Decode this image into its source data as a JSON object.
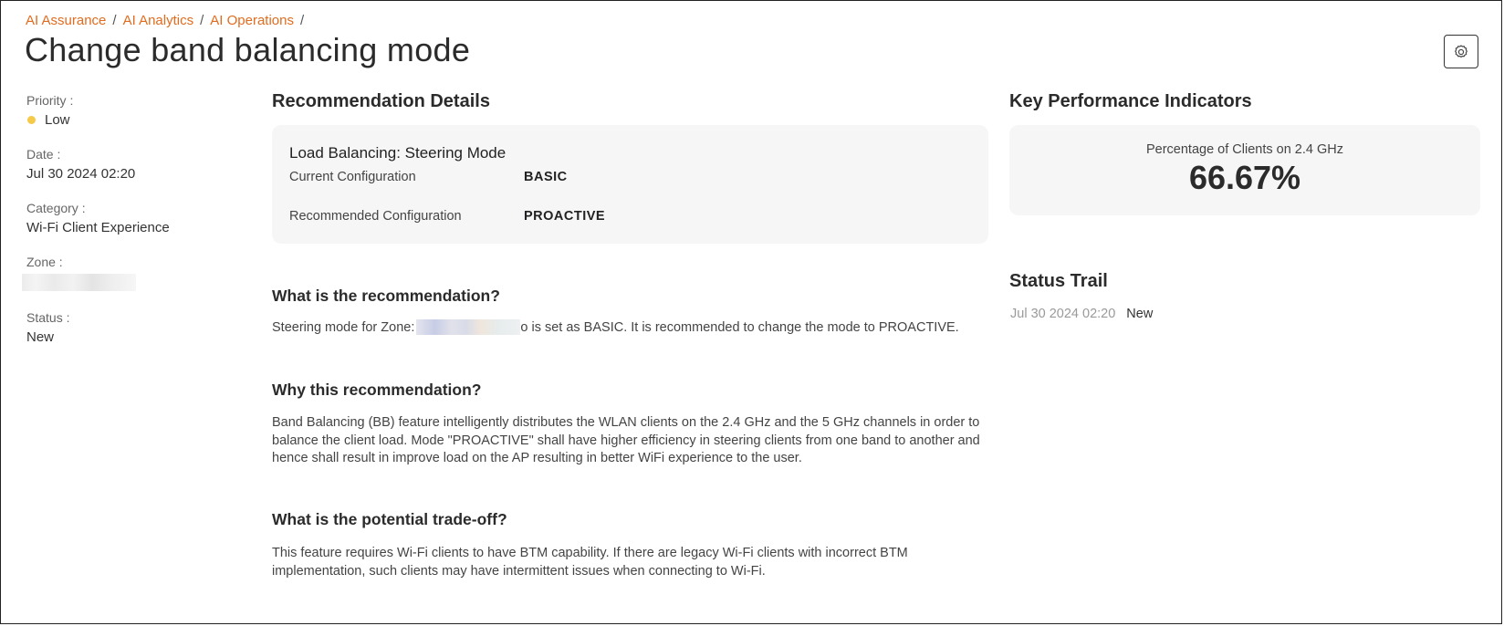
{
  "breadcrumb": [
    "AI Assurance",
    "AI Analytics",
    "AI Operations"
  ],
  "page_title": "Change band balancing mode",
  "icons": {
    "settings": "gear-icon"
  },
  "meta": {
    "priority_label": "Priority :",
    "priority_value": "Low",
    "priority_color": "#f7c948",
    "date_label": "Date :",
    "date_value": "Jul 30 2024 02:20",
    "category_label": "Category :",
    "category_value": "Wi-Fi Client Experience",
    "zone_label": "Zone :",
    "status_label": "Status :",
    "status_value": "New"
  },
  "recommendation": {
    "section_title": "Recommendation Details",
    "card_title": "Load Balancing: Steering Mode",
    "rows": [
      {
        "key": "Current Configuration",
        "value": "BASIC"
      },
      {
        "key": "Recommended Configuration",
        "value": "PROACTIVE"
      }
    ]
  },
  "what": {
    "title": "What is the recommendation?",
    "text_before": "Steering mode for Zone:",
    "text_after": "o is set as BASIC. It is recommended to change the mode to PROACTIVE."
  },
  "why": {
    "title": "Why this recommendation?",
    "text": "Band Balancing (BB) feature intelligently distributes the WLAN clients on the 2.4 GHz and the 5 GHz channels in order to balance the client load. Mode \"PROACTIVE\" shall have higher efficiency in steering clients from one band to another and hence shall result in improve load on the AP resulting in better WiFi experience to the user."
  },
  "tradeoff": {
    "title": "What is the potential trade-off?",
    "text": "This feature requires Wi-Fi clients to have BTM capability. If there are legacy Wi-Fi clients with incorrect BTM implementation, such clients may have intermittent issues when connecting to Wi-Fi."
  },
  "kpi": {
    "section_title": "Key Performance Indicators",
    "label": "Percentage of Clients on 2.4 GHz",
    "value": "66.67%"
  },
  "status_trail": {
    "title": "Status Trail",
    "entries": [
      {
        "date": "Jul 30 2024 02:20",
        "status": "New"
      }
    ]
  },
  "colors": {
    "accent": "#e06c1f",
    "card_bg": "#f6f6f7"
  }
}
